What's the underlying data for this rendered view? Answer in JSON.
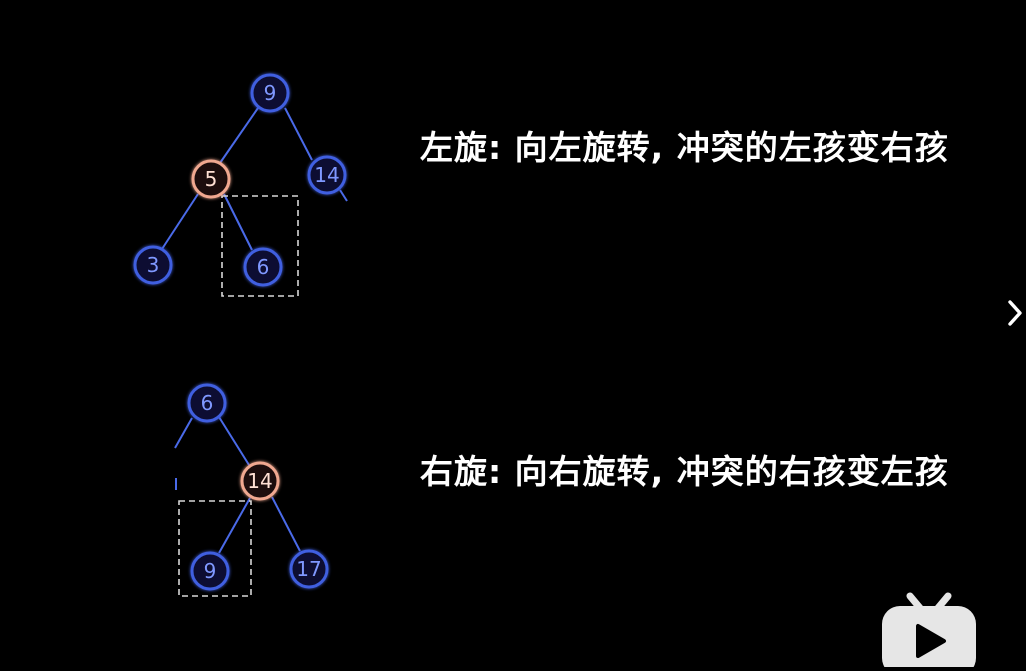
{
  "captions": {
    "left_rotation": "左旋: 向左旋转, 冲突的左孩变右孩",
    "right_rotation": "右旋: 向右旋转, 冲突的右孩变左孩"
  },
  "colors": {
    "background": "#000000",
    "node_blue": "#3f5fe0",
    "node_blue_fill": "#0a1030",
    "node_label_blue": "#7f98ff",
    "node_highlight": "#f0a890",
    "node_highlight_fill": "#1a0a08",
    "node_label_highlight": "#ffe0d4",
    "edge": "#4a6ae8",
    "dashed_box": "#d8d8d8",
    "caption": "#ffffff",
    "badge": "#e6e6e6"
  },
  "trees": [
    {
      "id": "left-rotation-tree",
      "nodes": [
        {
          "id": "n9",
          "label": "9",
          "highlight": false
        },
        {
          "id": "n5",
          "label": "5",
          "highlight": true
        },
        {
          "id": "n14",
          "label": "14",
          "highlight": false
        },
        {
          "id": "n3",
          "label": "3",
          "highlight": false
        },
        {
          "id": "n6",
          "label": "6",
          "highlight": false
        }
      ],
      "edges": [
        [
          "n9",
          "n5"
        ],
        [
          "n9",
          "n14"
        ],
        [
          "n5",
          "n3"
        ],
        [
          "n5",
          "n6"
        ]
      ],
      "conflict_child": "n6"
    },
    {
      "id": "right-rotation-tree",
      "nodes": [
        {
          "id": "m6",
          "label": "6",
          "highlight": false
        },
        {
          "id": "m14",
          "label": "14",
          "highlight": true
        },
        {
          "id": "m9",
          "label": "9",
          "highlight": false
        },
        {
          "id": "m17",
          "label": "17",
          "highlight": false
        }
      ],
      "edges": [
        [
          "m6",
          "m14"
        ],
        [
          "m14",
          "m9"
        ],
        [
          "m14",
          "m17"
        ]
      ],
      "conflict_child": "m9"
    }
  ],
  "icons": {
    "next_arrow": "chevron-right-icon",
    "player_badge": "bilibili-tv-icon"
  }
}
